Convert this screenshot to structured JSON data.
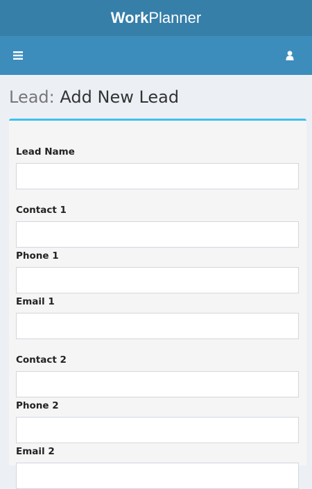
{
  "app": {
    "brand_bold": "Work",
    "brand_regular": "Planner"
  },
  "navbar": {
    "menu_icon": "hamburger-icon",
    "user_icon": "user-icon"
  },
  "page": {
    "module": "Lead:",
    "title": "Add New Lead"
  },
  "colors": {
    "brandbar": "#367fa9",
    "navbar": "#3c8dbc",
    "box_accent": "#3cc0f0",
    "background": "#ecf0f5"
  },
  "form": {
    "fields": [
      {
        "label": "Lead Name",
        "value": ""
      },
      {
        "label": "Contact 1",
        "value": ""
      },
      {
        "label": "Phone 1",
        "value": ""
      },
      {
        "label": "Email 1",
        "value": ""
      },
      {
        "label": "Contact 2",
        "value": ""
      },
      {
        "label": "Phone 2",
        "value": ""
      },
      {
        "label": "Email 2",
        "value": ""
      }
    ]
  }
}
